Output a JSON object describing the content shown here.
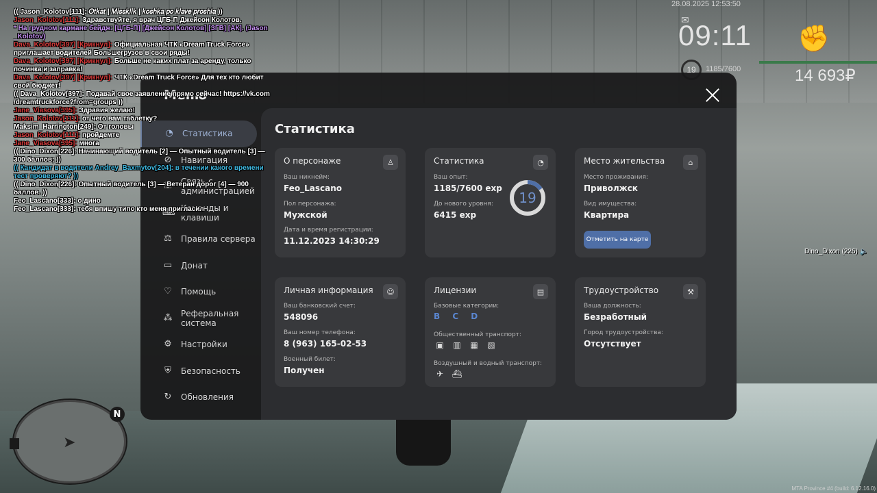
{
  "chat": [
    {
      "parts": [
        {
          "t": "(( Jason_Kolotov[111]: ",
          "c": "#ffffff"
        },
        {
          "t": "𝑂𝑡𝑘𝑎𝑡 | 𝑀𝑖𝑠𝑠𝑘𝑙𝑖𝑘 | 𝑘𝑜𝑠ℎ𝑘𝑎 𝑝𝑜 𝑘𝑙𝑎𝑣𝑒 𝑝𝑟𝑜𝑠ℎ𝑙𝑎",
          "c": "#ffffff"
        },
        {
          "t": " ))",
          "c": "#ffffff"
        }
      ]
    },
    {
      "parts": [
        {
          "t": "Jason_Kolotov[111]: ",
          "c": "#d83a3a"
        },
        {
          "t": "Здравствуйте, я врач ЦГБ-П Джейсон Колотов.",
          "c": "#ffffff"
        }
      ]
    },
    {
      "parts": [
        {
          "t": "* На грудном кармане бейдж: [ЦГБ-П] [Джейсон Колотов] [ЗГВ] [АК]. (Jason _Kolotov)",
          "c": "#c48ef0"
        }
      ]
    },
    {
      "parts": [
        {
          "t": "Dava_Kolotov[397] [Крикнул]: ",
          "c": "#d83a3a"
        },
        {
          "t": "Официальная ЧТК «Dream Truck Force» приглашает водителей Большегрузов в свои ряды!",
          "c": "#ffffff"
        }
      ]
    },
    {
      "parts": [
        {
          "t": "Dava_Kolotov[397] [Крикнул]: ",
          "c": "#d83a3a"
        },
        {
          "t": "Больше не каких плат за аренду, только починка и заправка!",
          "c": "#ffffff"
        }
      ]
    },
    {
      "parts": [
        {
          "t": "Dava_Kolotov[397] [Крикнул]: ",
          "c": "#d83a3a"
        },
        {
          "t": "ЧТК «Dream Truck Force» Для тех кто любит свой бюджет!",
          "c": "#ffffff"
        }
      ]
    },
    {
      "parts": [
        {
          "t": "(( Dava_Kolotov[397]: Подавай свое заявление прямо сейчас! https://vk.com /dreamtruckforce?from=groups ))",
          "c": "#ffffff"
        }
      ]
    },
    {
      "parts": [
        {
          "t": "Jane_Viasova[395]: ",
          "c": "#d83a3a"
        },
        {
          "t": "Здравия желаю!",
          "c": "#ffffff"
        }
      ]
    },
    {
      "parts": [
        {
          "t": "Jason_Kolotov[111]: ",
          "c": "#d83a3a"
        },
        {
          "t": "от чего вам таблетку?",
          "c": "#ffffff"
        }
      ]
    },
    {
      "parts": [
        {
          "t": "Maksim_Harrington[249]: От головы",
          "c": "#ffffff"
        }
      ]
    },
    {
      "parts": [
        {
          "t": "Jason_Kolotov[111]: ",
          "c": "#d83a3a"
        },
        {
          "t": "пройдемте",
          "c": "#ffffff"
        }
      ]
    },
    {
      "parts": [
        {
          "t": "Jane_Viasova[395]: ",
          "c": "#d83a3a"
        },
        {
          "t": "многа",
          "c": "#ffffff"
        }
      ]
    },
    {
      "parts": [
        {
          "t": "(( Dino_Dixon[226]: Начинающий водитель [2] — Опытный водитель [3] — 300 баллов; ))",
          "c": "#ffffff"
        }
      ]
    },
    {
      "parts": [
        {
          "t": "(( Кандидат в водители Andrey_Baxmytov[204]: в течении какого времени тест проверяют? ))",
          "c": "#3fb8e0"
        }
      ]
    },
    {
      "parts": [
        {
          "t": "(( Dino_Dixon[226]: Опытный водитель [3] — Ветеран дорог [4] — 900 баллов. ))",
          "c": "#ffffff"
        }
      ]
    },
    {
      "parts": [
        {
          "t": "Feo_Lascano[333]: о дино",
          "c": "#ffffff"
        }
      ]
    },
    {
      "parts": [
        {
          "t": "Feo_Lascano[333]: тебя впишу типо кто меня пригласил",
          "c": "#ffffff"
        }
      ]
    }
  ],
  "hud": {
    "date": "28.08.2025 12:53:50",
    "time": "09:11",
    "level": "19",
    "exp": "1185/7600",
    "money": "14 693₽",
    "player_tag": "Dino_Dixon (226)",
    "build": "MTA Province #4 (build: 6.12.16.0)",
    "north": "N"
  },
  "menu": {
    "title": "Меню",
    "content_title": "Статистика",
    "sidebar": [
      {
        "label": "Статистика",
        "icon": "pie-chart-icon"
      },
      {
        "label": "Навигация",
        "icon": "compass-icon"
      },
      {
        "label": "Связь с администрацией",
        "icon": "chat-icon"
      },
      {
        "label": "Команды и клавиши",
        "icon": "keyboard-icon"
      },
      {
        "label": "Правила сервера",
        "icon": "scales-icon"
      },
      {
        "label": "Донат",
        "icon": "wallet-icon"
      },
      {
        "label": "Помощь",
        "icon": "heart-hands-icon"
      },
      {
        "label": "Реферальная система",
        "icon": "network-icon"
      },
      {
        "label": "Настройки",
        "icon": "gear-icon"
      },
      {
        "label": "Безопасность",
        "icon": "shield-icon"
      },
      {
        "label": "Обновления",
        "icon": "refresh-icon"
      }
    ],
    "cards": {
      "character": {
        "title": "О персонаже",
        "nick_label": "Ваш никнейм:",
        "nick": "Feo_Lascano",
        "gender_label": "Пол персонажа:",
        "gender": "Мужской",
        "reg_label": "Дата и время регистрации:",
        "reg": "11.12.2023 14:30:29"
      },
      "stats": {
        "title": "Статистика",
        "exp_label": "Ваш опыт:",
        "exp": "1185/7600 exp",
        "next_label": "До нового уровня:",
        "next": "6415 exp",
        "level": "19",
        "progress": 0.156
      },
      "residence": {
        "title": "Место жительства",
        "place_label": "Место проживания:",
        "place": "Приволжск",
        "property_label": "Вид имущества:",
        "property": "Квартира",
        "button": "Отметить на карте"
      },
      "personal": {
        "title": "Личная информация",
        "bank_label": "Ваш банковский счет:",
        "bank": "548096",
        "phone_label": "Ваш номер телефона:",
        "phone": "8 (963) 165-02-53",
        "military_label": "Военный билет:",
        "military": "Получен"
      },
      "licenses": {
        "title": "Лицензии",
        "base_label": "Базовые категории:",
        "base": "B C D",
        "public_label": "Общественный транспорт:",
        "air_label": "Воздушный и водный транспорт:"
      },
      "employment": {
        "title": "Трудоустройство",
        "position_label": "Ваша должность:",
        "position": "Безработный",
        "city_label": "Город трудоустройства:",
        "city": "Отсутствует"
      }
    }
  },
  "colors": {
    "accent": "#4f6fa7",
    "panel": "#18181a",
    "card": "#38393c"
  }
}
